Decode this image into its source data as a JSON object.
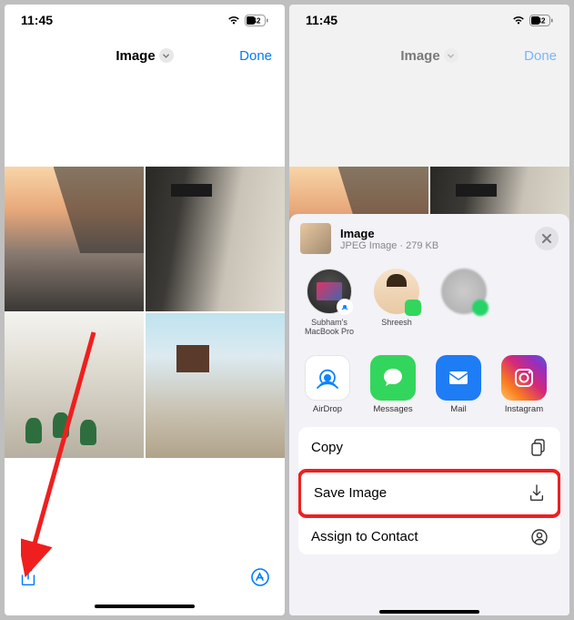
{
  "status": {
    "time": "11:45",
    "battery": "42"
  },
  "nav": {
    "title": "Image",
    "done": "Done"
  },
  "share": {
    "title": "Image",
    "subtitle": "JPEG Image · 279 KB",
    "targets": [
      {
        "label": "Subham's\nMacBook Pro"
      },
      {
        "label": "Shreesh"
      },
      {
        "label": " "
      }
    ],
    "apps": [
      {
        "label": "AirDrop"
      },
      {
        "label": "Messages"
      },
      {
        "label": "Mail"
      },
      {
        "label": "Instagram"
      }
    ],
    "actions": [
      {
        "label": "Copy"
      },
      {
        "label": "Save Image"
      },
      {
        "label": "Assign to Contact"
      }
    ]
  }
}
